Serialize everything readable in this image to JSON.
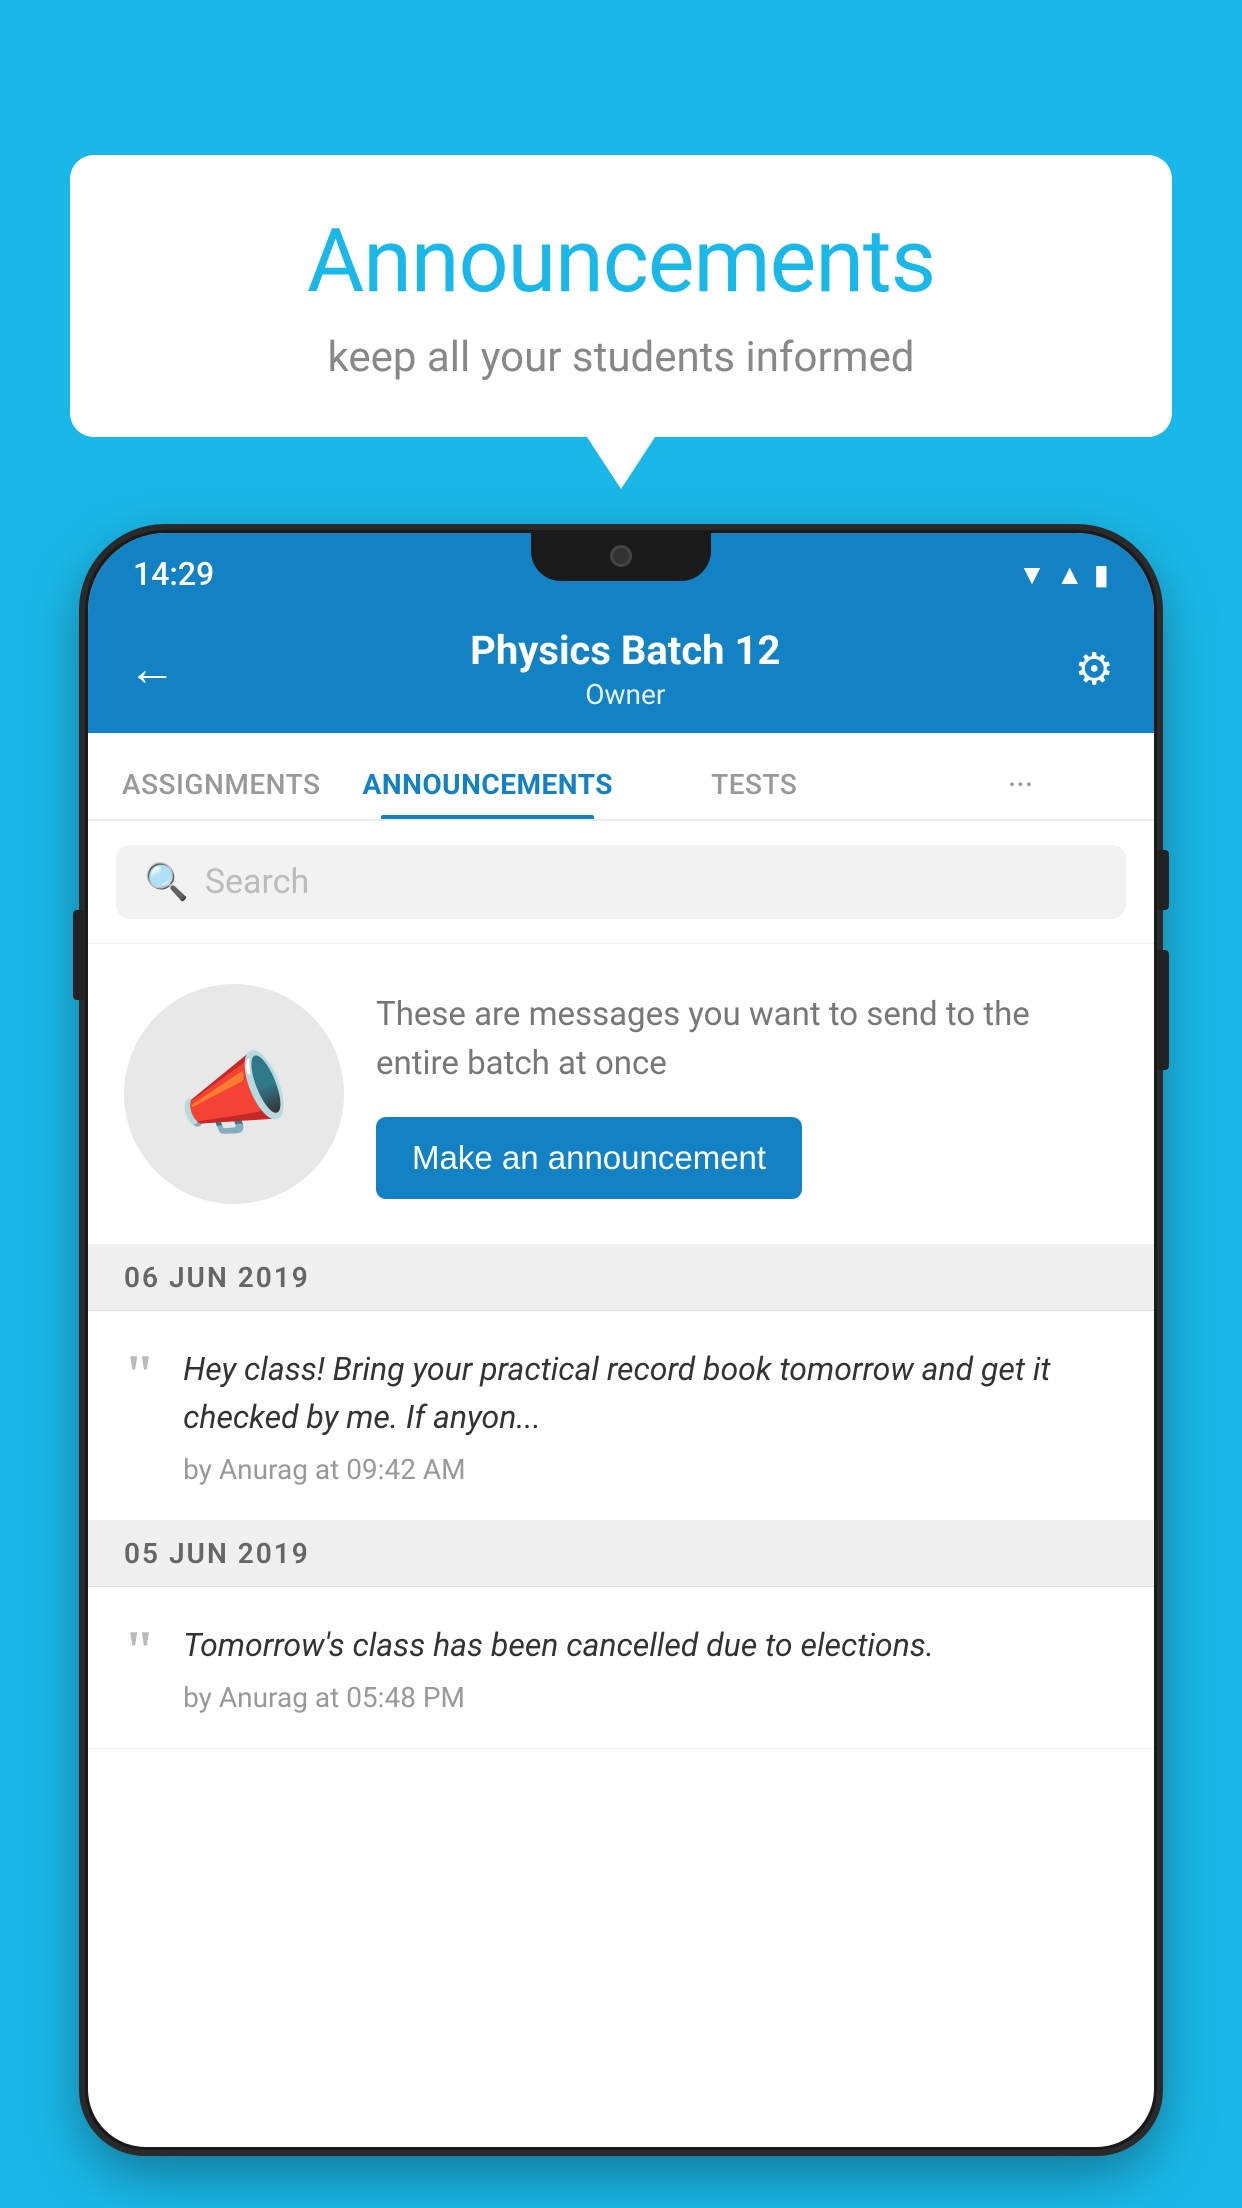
{
  "background_color": "#1ab8e8",
  "speech_bubble": {
    "title": "Announcements",
    "subtitle": "keep all your students informed"
  },
  "status_bar": {
    "time": "14:29",
    "icons": [
      "wifi",
      "signal",
      "battery"
    ]
  },
  "header": {
    "batch_name": "Physics Batch 12",
    "role": "Owner",
    "back_label": "←",
    "settings_label": "⚙"
  },
  "tabs": [
    {
      "label": "ASSIGNMENTS",
      "active": false
    },
    {
      "label": "ANNOUNCEMENTS",
      "active": true
    },
    {
      "label": "TESTS",
      "active": false
    },
    {
      "label": "···",
      "active": false
    }
  ],
  "search": {
    "placeholder": "Search"
  },
  "promo": {
    "description": "These are messages you want to send to the entire batch at once",
    "button_label": "Make an announcement"
  },
  "announcements": [
    {
      "date": "06  JUN  2019",
      "text": "Hey class! Bring your practical record book tomorrow and get it checked by me. If anyon...",
      "meta": "by Anurag at 09:42 AM"
    },
    {
      "date": "05  JUN  2019",
      "text": "Tomorrow's class has been cancelled due to elections.",
      "meta": "by Anurag at 05:48 PM"
    }
  ]
}
